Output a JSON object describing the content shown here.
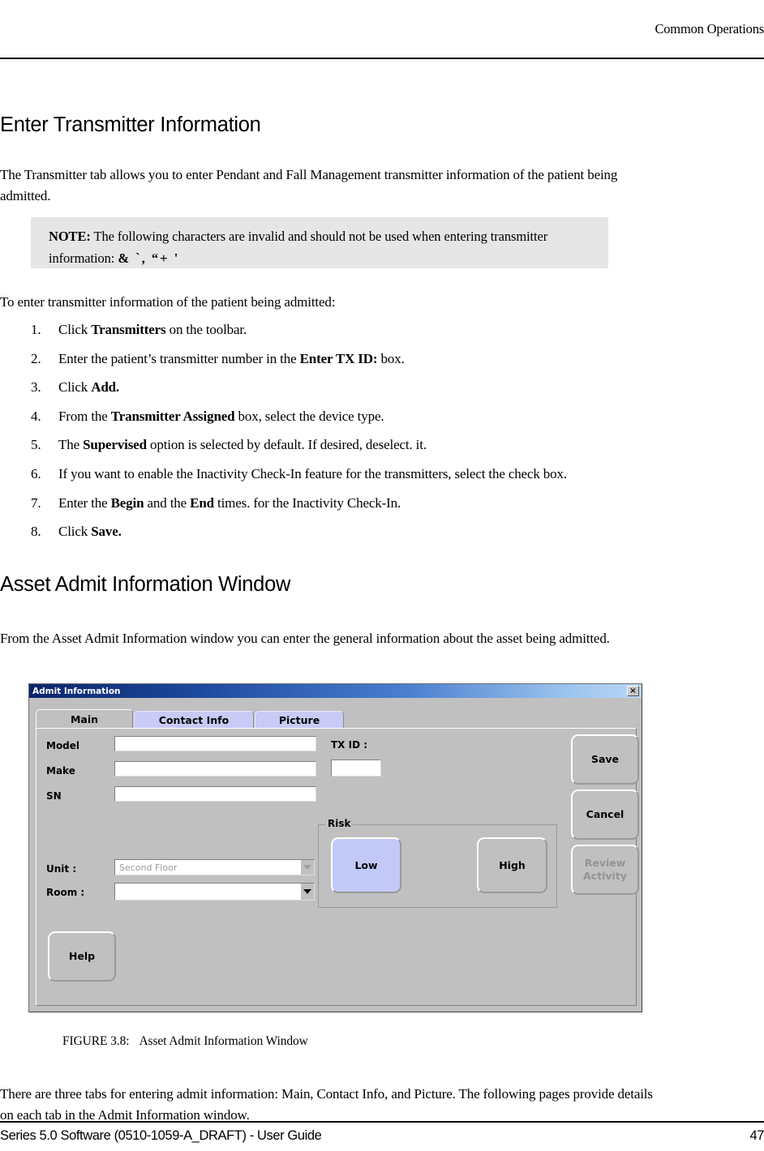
{
  "header": {
    "running_head": "Common Operations"
  },
  "sections": {
    "transmitter": {
      "title": "Enter Transmitter Information",
      "intro": "The Transmitter tab allows you to enter Pendant and Fall Management transmitter information of the patient being admitted.",
      "note": {
        "label": "NOTE:",
        "text": " The following characters are invalid and should not be used when entering transmitter information: ",
        "invalid_characters": "&   `,   “+   '"
      },
      "lead_in": "To enter transmitter information of the patient being admitted:",
      "steps": [
        {
          "num": "1.",
          "html": "Click <b>Transmitters</b> on the toolbar."
        },
        {
          "num": "2.",
          "html": "Enter the patient’s transmitter number in the <b>Enter TX ID:</b> box."
        },
        {
          "num": "3.",
          "html": "Click <b>Add.</b>"
        },
        {
          "num": "4.",
          "html": "From the <b>Transmitter Assigned</b> box, select the device type."
        },
        {
          "num": "5.",
          "html": "The <b>Supervised</b> option is selected by default. If desired, deselect. it."
        },
        {
          "num": "6.",
          "html": "If you want to enable the Inactivity Check-In feature for the transmitters, select the check box."
        },
        {
          "num": "7.",
          "html": "Enter the <b>Begin</b> and the <b>End</b> times. for the Inactivity Check-In."
        },
        {
          "num": "8.",
          "html": "Click <b>Save.</b>"
        }
      ]
    },
    "asset_admit": {
      "title": "Asset Admit Information Window",
      "intro": "From the Asset Admit Information window you can enter the general information about the asset being admitted.",
      "closing": "There are three tabs for entering admit information: Main, Contact Info, and Picture. The following pages provide details on each tab in the Admit Information window."
    }
  },
  "figure": {
    "number": "FIGURE 3.8:",
    "caption": "Asset Admit Information Window"
  },
  "dialog": {
    "title": "Admit Information",
    "close_label": "×",
    "tabs": [
      {
        "label": "Main",
        "active": true
      },
      {
        "label": "Contact Info",
        "active": false
      },
      {
        "label": "Picture",
        "active": false
      }
    ],
    "fields": {
      "model_label": "Model",
      "model_value": "",
      "make_label": "Make",
      "make_value": "",
      "sn_label": "SN",
      "sn_value": "",
      "txid_label": "TX ID :",
      "txid_value": "",
      "unit_label": "Unit :",
      "unit_value": "Second Floor",
      "room_label": "Room :",
      "room_value": ""
    },
    "risk": {
      "group_label": "Risk",
      "low_label": "Low",
      "high_label": "High",
      "selected": "Low"
    },
    "buttons": {
      "save": "Save",
      "cancel": "Cancel",
      "review_activity_line1": "Review",
      "review_activity_line2": "Activity",
      "help": "Help"
    },
    "colors": {
      "titlebar_start": "#0a246a",
      "titlebar_end": "#b9d6f5",
      "face": "#c0c0c0",
      "tab_inactive": "#c9caf5",
      "selected_button": "#c3c9f7"
    }
  },
  "footer": {
    "left": "Series 5.0 Software (0510-1059-A_DRAFT) - User Guide",
    "page": "47"
  }
}
